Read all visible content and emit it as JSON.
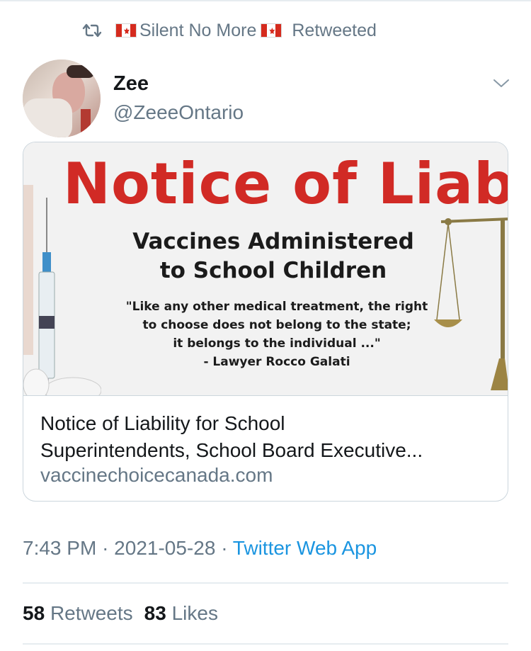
{
  "retweet_banner": {
    "icon": "retweet-icon",
    "flag_icon": "canada-flag-icon",
    "retweeter_name": "Silent No More",
    "label": "Retweeted"
  },
  "tweet": {
    "author": {
      "display_name": "Zee",
      "handle": "@ZeeeOntario",
      "avatar_icon": "avatar"
    },
    "menu_icon": "chevron-down-icon",
    "link_card": {
      "image": {
        "headline": "Notice of Liabil",
        "subheading_line1": "Vaccines Administered",
        "subheading_line2": "to School Children",
        "quote_line1": "\"Like any other medical treatment, the right",
        "quote_line2": "to choose does not belong to the state;",
        "quote_line3": "it belongs to the individual ...\"",
        "quote_line4": "- Lawyer Rocco Galati"
      },
      "title_line1": "Notice of Liability for School",
      "title_line2": "Superintendents, School Board Executive...",
      "domain": "vaccinechoicecanada.com"
    },
    "time": "7:43 PM",
    "separator": "·",
    "date": "2021-05-28",
    "source_app": "Twitter Web App",
    "stats": {
      "retweets_count": "58",
      "retweets_label": "Retweets",
      "likes_count": "83",
      "likes_label": "Likes"
    }
  },
  "colors": {
    "text_primary": "#14171a",
    "text_secondary": "#657786",
    "link_blue": "#1b95e0",
    "border": "#ccd6dd",
    "headline_red": "#d12a25"
  }
}
